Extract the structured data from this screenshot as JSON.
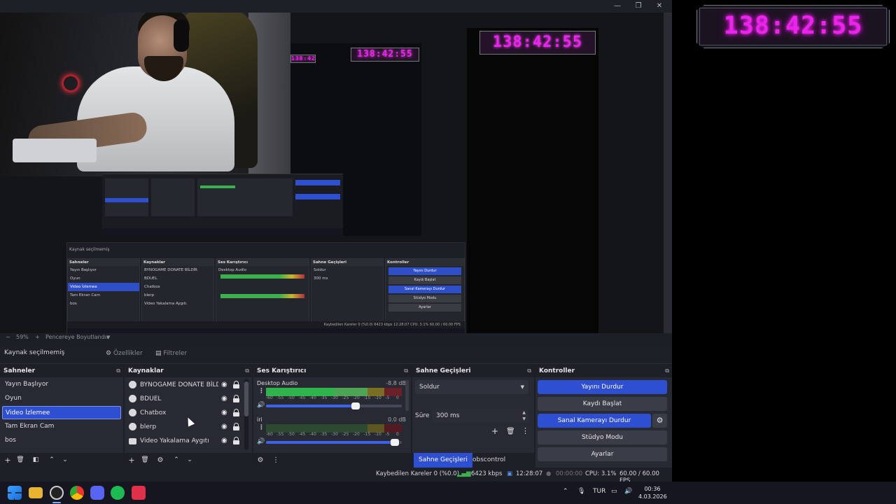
{
  "timer": {
    "value": "138:42:55"
  },
  "context": {
    "text": "Kaynak seçilmemiş",
    "properties": "Özellikler",
    "filters": "Filtreler"
  },
  "zoom": {
    "minus": "−",
    "value": "59%",
    "plus": "+",
    "fit": "Pencereye Boyutlandır"
  },
  "scenes": {
    "title": "Sahneler",
    "items": [
      "Yayın Başlıyor",
      "Oyun",
      "Video İzlemee",
      "Tam Ekran Cam",
      "bos"
    ],
    "selected_index": 2
  },
  "sources": {
    "title": "Kaynaklar",
    "items": [
      "BYNOGAME DONATE BİLDİR",
      "BDUEL",
      "Chatbox",
      "blerp",
      "Video Yakalama Aygıtı"
    ]
  },
  "mixer": {
    "title": "Ses Karıştırıcı",
    "channels": [
      {
        "name": "Desktop Audio",
        "db": "-8.8 dB",
        "volume": 0.66
      },
      {
        "name": "iri",
        "db": "0.0 dB",
        "volume": 0.95
      }
    ],
    "scale": [
      "-60",
      "-55",
      "-50",
      "-45",
      "-40",
      "-35",
      "-30",
      "-25",
      "-20",
      "-15",
      "-10",
      "-5",
      "0"
    ]
  },
  "transitions": {
    "title": "Sahne Geçişleri",
    "selected": "Soldur",
    "duration_label": "Süre",
    "duration": "300 ms",
    "tabs": [
      "Sahne Geçişleri",
      "obscontrol"
    ]
  },
  "controls": {
    "title": "Kontroller",
    "stop_stream": "Yayını Durdur",
    "start_recording": "Kaydı Başlat",
    "stop_virtualcam": "Sanal Kamerayı Durdur",
    "studio_mode": "Stüdyo Modu",
    "settings": "Ayarlar"
  },
  "status": {
    "dropped": "Kaybedilen Kareler 0 (%0.0)",
    "bitrate": "6423 kbps",
    "stream_time": "12:28:07",
    "rec_time": "00:00:00",
    "cpu": "CPU: 3.1%",
    "fps": "60.00 / 60.00 FPS"
  },
  "taskbar": {
    "lang": "TUR",
    "time": "00:36",
    "date": "4.03.2026"
  },
  "mini": {
    "context": "Kaynak seçilmemiş",
    "scenes_title": "Sahneler",
    "sources_title": "Kaynaklar",
    "mixer_title": "Ses Karıştırıcı",
    "trans_title": "Sahne Geçişleri",
    "controls_title": "Kontroller",
    "desktop_audio": "Desktop Audio",
    "status": "Kaybedilen Kareler 0 (%0.0)   6423 kbps   12:28:07   CPU: 3.1%   60.00 / 60.00 FPS"
  }
}
